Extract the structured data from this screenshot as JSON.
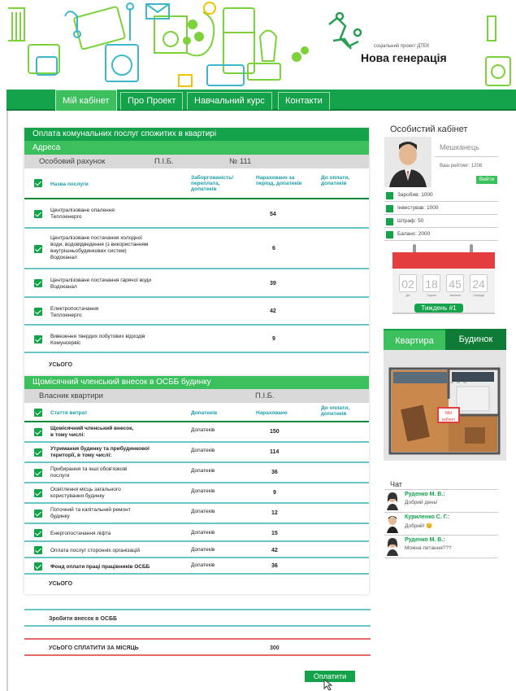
{
  "brand": {
    "subtitle": "соціальний проект ДТЕК",
    "title": "Нова генерація"
  },
  "nav": {
    "items": [
      "Мій кабінет",
      "Про Проект",
      "Навчальний курс",
      "Контакти"
    ]
  },
  "utilities": {
    "title": "Оплата комунальних послуг спожитих в квартирі",
    "address_label": "Адреса",
    "account": {
      "label": "Особовий рахунок",
      "name": "П.І.Б.",
      "number": "№ 111"
    },
    "columns": [
      "Назва послуги",
      "Заборгованість/ переплата, допатеків",
      "Нараховано за період, допатеків",
      "До оплати, допатеків"
    ],
    "rows": [
      {
        "name": "Централізоване опалення\nТеплоенерго",
        "value": "54"
      },
      {
        "name": "Централізоване постачання холодної\nводи, водовідведення (з використанням\nвнутрішньобудинкових систем)\nВодоканал",
        "value": "6"
      },
      {
        "name": "Централізоване постачання гарячої води\nВодоканал",
        "value": "39"
      },
      {
        "name": "Електропостачання\nТеплоенерго",
        "value": "42"
      },
      {
        "name": "Вивезення твердих побутових відходів\nКомунсервіс",
        "value": "9"
      }
    ],
    "total_label": "УСЬОГО"
  },
  "osbb": {
    "title": "Щомісячний членський внесок в ОСББ будинку",
    "owner": {
      "label": "Власник квартири",
      "name": "П.І.Б."
    },
    "columns": [
      "Стаття витрат",
      "Допатеків",
      "Нараховано",
      "До оплати, допатеків"
    ],
    "rows": [
      {
        "name": "Щомісячний членський внесок,\nв тому числі:",
        "cat": "Допатеків",
        "value": "150",
        "bold": true
      },
      {
        "name": "Утримання будинку та прибудинкової\nтериторії, в тому числі:",
        "cat": "Допатеків",
        "value": "114",
        "bold": true
      },
      {
        "name": "Прибирання та інші обов'язкові\nпослуги",
        "cat": "Допатеків",
        "value": "36"
      },
      {
        "name": "Освітлення місць загального\nкористування будинку",
        "cat": "Допатеків",
        "value": "9"
      },
      {
        "name": "Поточний та капітальний ремонт\nбудинку",
        "cat": "Допатеків",
        "value": "12"
      },
      {
        "name": "Енергопостачання ліфта",
        "cat": "Допатеків",
        "value": "15"
      },
      {
        "name": "Оплата послуг сторонніх організацій",
        "cat": "Допатеків",
        "value": "42"
      },
      {
        "name": "Фонд оплати праці працівників ОСББ",
        "cat": "Допатеків",
        "value": "36",
        "bold": true
      }
    ],
    "total_label": "УСЬОГО"
  },
  "contribute_label": "Зробити внесок в ОСББ",
  "grand_total": {
    "label": "УСЬОГО СПЛАТИТИ ЗА МІСЯЦЬ",
    "value": "300"
  },
  "pay_button": "Оплатити",
  "cabinet": {
    "title": "Особистий кабінет",
    "status": "Мешканець",
    "rating": "Ваш рейтинг: 1208",
    "logout": "Вийти",
    "stats": [
      "Заробив: 1000",
      "Інвестував: 1000",
      "Штраф: 50",
      "Баланс: 2000"
    ]
  },
  "calendar": {
    "digits": [
      "02",
      "18",
      "45",
      "24"
    ],
    "labels": [
      "Дні",
      "Години",
      "Хвилини",
      "Секунди"
    ],
    "week": "Тиждень #1"
  },
  "tabs": {
    "apartment": "Квартира",
    "building": "Будинок"
  },
  "plan_label": "Мій кабінет",
  "chat": {
    "title": "Чат",
    "messages": [
      {
        "who": "Руденко М. В.:",
        "msg": "Добрий день!"
      },
      {
        "who": "Куриленко С. Г.:",
        "msg": "Добрий! 😊"
      },
      {
        "who": "Руденко М. В.:",
        "msg": "Можна питання???"
      }
    ]
  },
  "colors": {
    "green": "#14a24a",
    "light_green": "#3cc05e",
    "red": "#e43d3d",
    "teal": "#6ac6c6"
  }
}
